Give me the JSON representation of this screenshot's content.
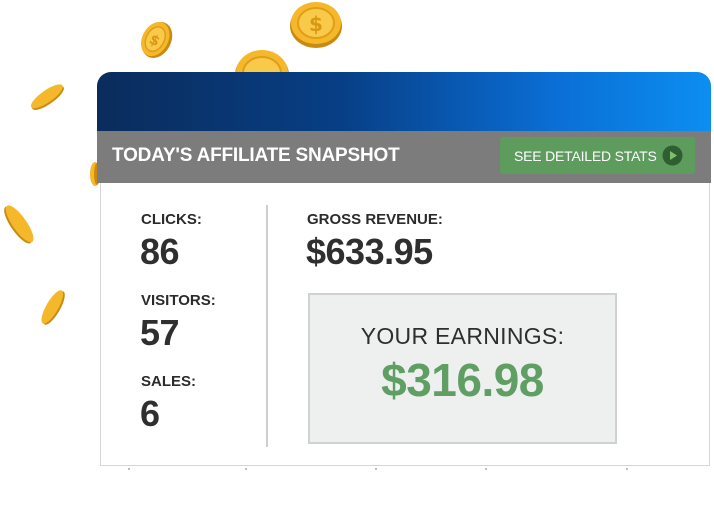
{
  "header": {
    "title": "TODAY'S AFFILIATE SNAPSHOT",
    "details_button_label": "SEE DETAILED STATS",
    "details_button_icon": "play-circle-icon"
  },
  "metrics": {
    "clicks": {
      "label": "CLICKS:",
      "value": "86"
    },
    "visitors": {
      "label": "VISITORS:",
      "value": "57"
    },
    "sales": {
      "label": "SALES:",
      "value": "6"
    },
    "gross_revenue": {
      "label": "GROSS REVENUE:",
      "value": "$633.95"
    }
  },
  "earnings": {
    "label": "YOUR EARNINGS:",
    "value": "$316.98"
  },
  "colors": {
    "header_gradient_start": "#0b2c5b",
    "header_gradient_end": "#0c8ef0",
    "header_bar": "#7c7c7c",
    "button_green": "#5e9c5e",
    "earnings_green": "#5f9f63",
    "coin_gold": "#f3b21d"
  },
  "decorations": {
    "coin_icon": "gold-coin-icon"
  }
}
